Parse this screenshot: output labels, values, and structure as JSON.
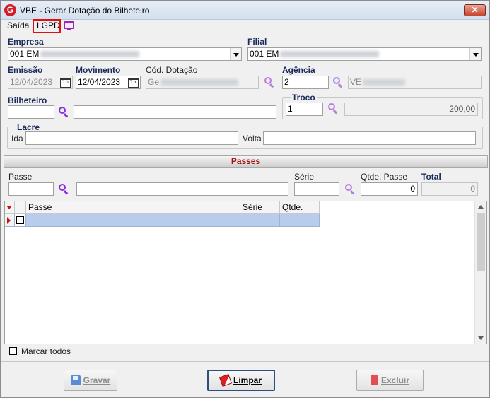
{
  "window": {
    "title": "VBE - Gerar Dotação do Bilheteiro",
    "close_label": "✕",
    "app_icon_glyph": "G"
  },
  "menu": {
    "saida": "Saída",
    "lgpd": "LGPD"
  },
  "form": {
    "empresa_label": "Empresa",
    "empresa_value": "001 EM",
    "filial_label": "Filial",
    "filial_value": "001 EM",
    "emissao_label": "Emissão",
    "emissao_value": "12/04/2023",
    "movimento_label": "Movimento",
    "movimento_value": "12/04/2023",
    "cod_dotacao_label": "Cód. Dotação",
    "cod_dotacao_value": "Ge",
    "agencia_label": "Agência",
    "agencia_code": "2",
    "agencia_name": "VE",
    "bilheteiro_label": "Bilheteiro",
    "bilheteiro_code": "",
    "bilheteiro_name": "",
    "troco_label": "Troco",
    "troco_code": "1",
    "troco_value": "200,00",
    "calendar_glyph": "15",
    "lacre_label": "Lacre",
    "ida_label": "Ida",
    "ida_value": "",
    "volta_label": "Volta",
    "volta_value": ""
  },
  "passes": {
    "header": "Passes",
    "passe_label": "Passe",
    "serie_label": "Série",
    "qtde_passe_label": "Qtde. Passe",
    "qtde_passe_value": "0",
    "total_label": "Total",
    "total_value": "0",
    "grid_columns": [
      "Passe",
      "Série",
      "Qtde."
    ],
    "marcar_todos_label": "Marcar todos"
  },
  "buttons": {
    "gravar": "Gravar",
    "limpar": "Limpar",
    "excluir": "Excluir"
  },
  "colors": {
    "title_red": "#d21e2a",
    "passes_header": "#a01010",
    "search_icon": "#8a2be2",
    "selected_row": "#b8cdee"
  },
  "icons": {
    "search": "search-icon",
    "calendar": "calendar-icon",
    "monitor": "monitor-icon"
  }
}
